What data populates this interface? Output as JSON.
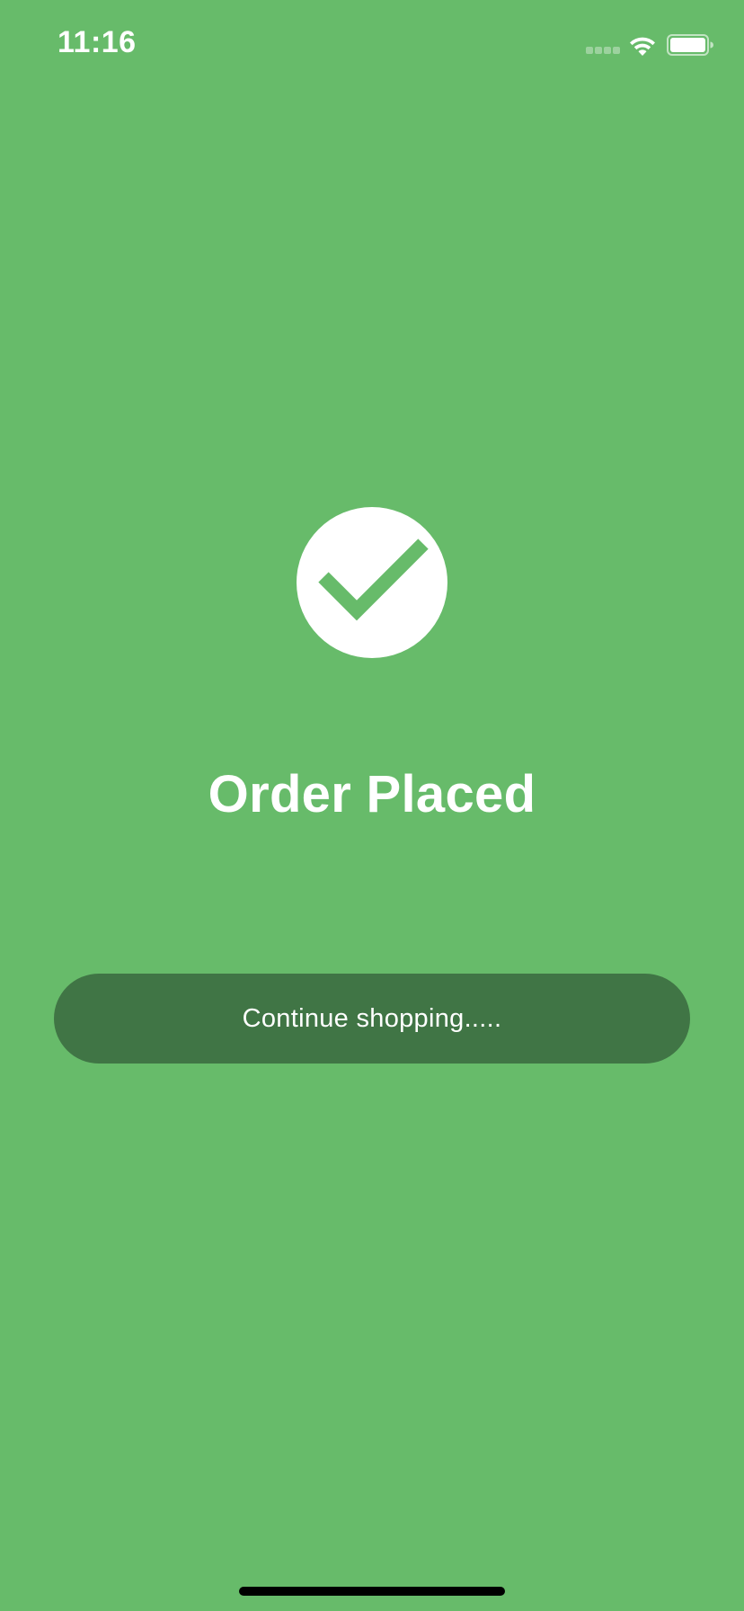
{
  "status_bar": {
    "time": "11:16"
  },
  "icons": {
    "status": [
      "cellular-signal-icon",
      "wifi-icon",
      "battery-icon"
    ],
    "confirmation": "checkmark-circle-icon"
  },
  "colors": {
    "background": "#67bb6a",
    "button": "#407545",
    "text": "#ffffff",
    "home_indicator": "#000000"
  },
  "main": {
    "title": "Order Placed",
    "continue_label": "Continue shopping....."
  }
}
